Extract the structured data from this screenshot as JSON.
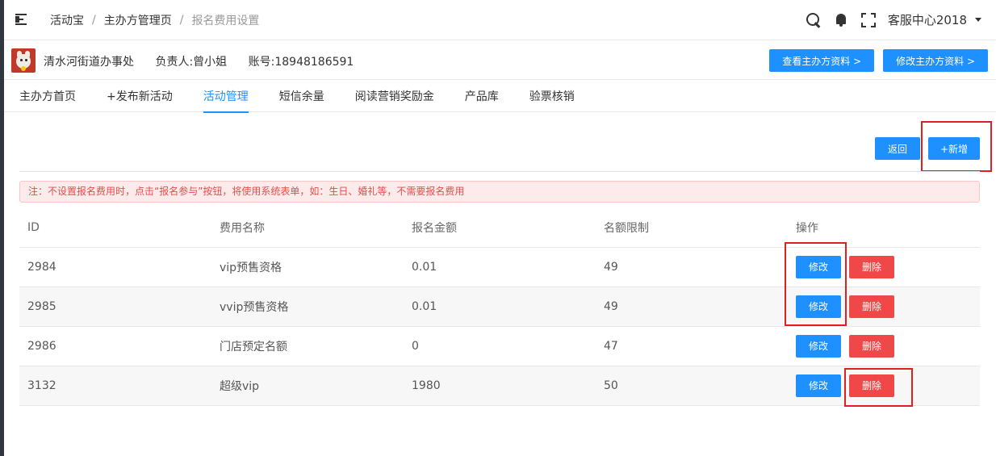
{
  "header": {
    "breadcrumb": [
      "活动宝",
      "主办方管理页",
      "报名费用设置"
    ],
    "user_label": "客服中心2018",
    "icons": [
      "menu-toggle-icon",
      "search-icon",
      "bell-icon",
      "fullscreen-icon"
    ]
  },
  "organizer": {
    "name": "清水河街道办事处",
    "manager": "负责人:曾小姐",
    "account": "账号:18948186591",
    "view_btn": "查看主办方资料 >",
    "edit_btn": "修改主办方资料 >"
  },
  "tabs": [
    {
      "label": "主办方首页",
      "active": false
    },
    {
      "label": "+发布新活动",
      "active": false
    },
    {
      "label": "活动管理",
      "active": true
    },
    {
      "label": "短信余量",
      "active": false
    },
    {
      "label": "阅读营销奖励金",
      "active": false
    },
    {
      "label": "产品库",
      "active": false
    },
    {
      "label": "验票核销",
      "active": false
    }
  ],
  "actions": {
    "back": "返回",
    "add": "+新增"
  },
  "notice": "注：不设置报名费用时，点击“报名参与”按钮，将使用系统表单，如：生日、婚礼等，不需要报名费用",
  "table": {
    "headers": [
      "ID",
      "费用名称",
      "报名金额",
      "名额限制",
      "操作"
    ],
    "rows": [
      {
        "id": "2984",
        "name": "vip预售资格",
        "amount": "0.01",
        "limit": "49",
        "edit": "修改",
        "delete": "删除"
      },
      {
        "id": "2985",
        "name": "vvip预售资格",
        "amount": "0.01",
        "limit": "49",
        "edit": "修改",
        "delete": "删除"
      },
      {
        "id": "2986",
        "name": "门店预定名额",
        "amount": "0",
        "limit": "47",
        "edit": "修改",
        "delete": "删除"
      },
      {
        "id": "3132",
        "name": "超级vip",
        "amount": "1980",
        "limit": "50",
        "edit": "修改",
        "delete": "删除"
      }
    ]
  },
  "colors": {
    "primary": "#1e90ff",
    "danger": "#f04848",
    "highlight": "#e02020",
    "notice_bg": "#fdeaea"
  }
}
